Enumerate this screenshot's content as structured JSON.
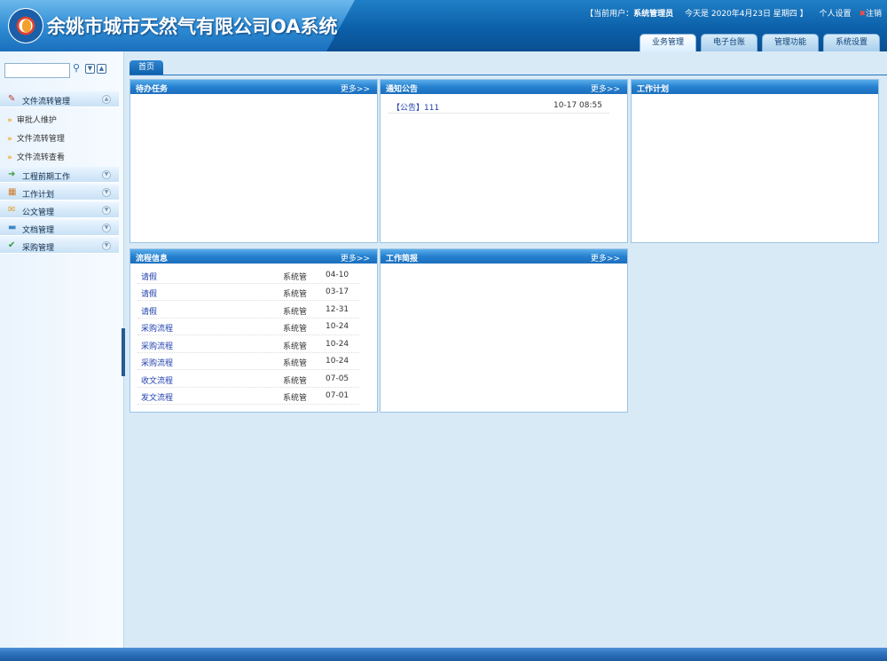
{
  "header": {
    "title": "余姚市城市天然气有限公司OA系统",
    "user_label": "【当前用户：",
    "user_name": "系统管理员",
    "today_text": "今天是 2020年4月23日 星期四 】",
    "personal_settings": "个人设置",
    "logout": "注销"
  },
  "top_tabs": [
    "业务管理",
    "电子台账",
    "管理功能",
    "系统设置"
  ],
  "sidebar": {
    "search_placeholder": "",
    "groups": [
      {
        "label": "文件流转管理",
        "icon": "pencil-icon"
      },
      {
        "label": "工程前期工作",
        "icon": "arrow-icon"
      },
      {
        "label": "工作计划",
        "icon": "calendar-icon"
      },
      {
        "label": "公文管理",
        "icon": "mail-icon"
      },
      {
        "label": "文档管理",
        "icon": "folder-icon"
      },
      {
        "label": "采购管理",
        "icon": "check-icon"
      }
    ],
    "sub_items": [
      "审批人维护",
      "文件流转管理",
      "文件流转查看"
    ]
  },
  "home_tab": "首页",
  "panels": {
    "todo": {
      "title": "待办任务",
      "more": "更多>>"
    },
    "notice": {
      "title": "通知公告",
      "more": "更多>>",
      "items": [
        {
          "title": "【公告】111",
          "time": "10-17 08:55"
        }
      ]
    },
    "plan": {
      "title": "工作计划"
    },
    "flow": {
      "title": "流程信息",
      "more": "更多>>",
      "rows": [
        {
          "name": "请假",
          "user": "系统管",
          "date": "04-10"
        },
        {
          "name": "请假",
          "user": "系统管",
          "date": "03-17"
        },
        {
          "name": "请假",
          "user": "系统管",
          "date": "12-31"
        },
        {
          "name": "采购流程",
          "user": "系统管",
          "date": "10-24"
        },
        {
          "name": "采购流程",
          "user": "系统管",
          "date": "10-24"
        },
        {
          "name": "采购流程",
          "user": "系统管",
          "date": "10-24"
        },
        {
          "name": "收文流程",
          "user": "系统管",
          "date": "07-05"
        },
        {
          "name": "发文流程",
          "user": "系统管",
          "date": "07-01"
        }
      ]
    },
    "brief": {
      "title": "工作简报",
      "more": "更多>>"
    }
  },
  "colors": {
    "brand": "#0b5ea7",
    "link": "#1f3fae",
    "accent": "#f0a020"
  }
}
